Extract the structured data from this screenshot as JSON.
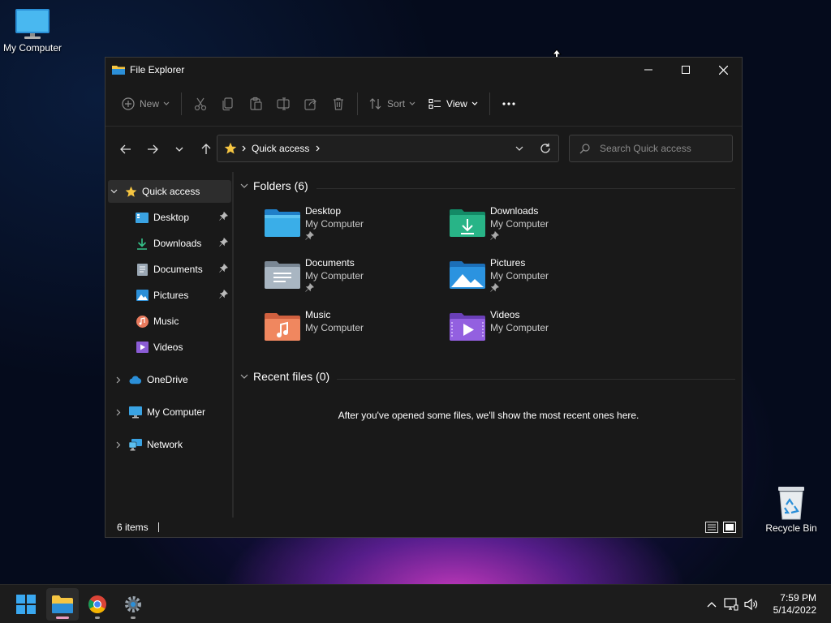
{
  "desktop": {
    "icons": [
      {
        "label": "My Computer"
      },
      {
        "label": "Recycle Bin"
      }
    ]
  },
  "window": {
    "title": "File Explorer",
    "toolbar": {
      "new_label": "New",
      "sort_label": "Sort",
      "view_label": "View"
    },
    "address": {
      "crumb": "Quick access"
    },
    "search": {
      "placeholder": "Search Quick access"
    },
    "nav": {
      "quick_access": "Quick access",
      "items": [
        {
          "label": "Desktop",
          "pinned": true
        },
        {
          "label": "Downloads",
          "pinned": true
        },
        {
          "label": "Documents",
          "pinned": true
        },
        {
          "label": "Pictures",
          "pinned": true
        },
        {
          "label": "Music",
          "pinned": false
        },
        {
          "label": "Videos",
          "pinned": false
        }
      ],
      "onedrive": "OneDrive",
      "my_computer": "My Computer",
      "network": "Network"
    },
    "folders_header": "Folders (6)",
    "folders": [
      {
        "name": "Desktop",
        "location": "My Computer",
        "pinned": true
      },
      {
        "name": "Downloads",
        "location": "My Computer",
        "pinned": true
      },
      {
        "name": "Documents",
        "location": "My Computer",
        "pinned": true
      },
      {
        "name": "Pictures",
        "location": "My Computer",
        "pinned": true
      },
      {
        "name": "Music",
        "location": "My Computer",
        "pinned": false
      },
      {
        "name": "Videos",
        "location": "My Computer",
        "pinned": false
      }
    ],
    "recent_header": "Recent files (0)",
    "recent_empty": "After you've opened some files, we'll show the most recent ones here.",
    "status": {
      "item_count": "6 items"
    }
  },
  "taskbar": {
    "clock": {
      "time": "7:59 PM",
      "date": "5/14/2022"
    }
  },
  "colors": {
    "folder_yellow": "#f5c542",
    "accent_blue": "#4cc2ff",
    "taskbar_bg": "#1c1c1c",
    "window_bg": "#191919"
  }
}
